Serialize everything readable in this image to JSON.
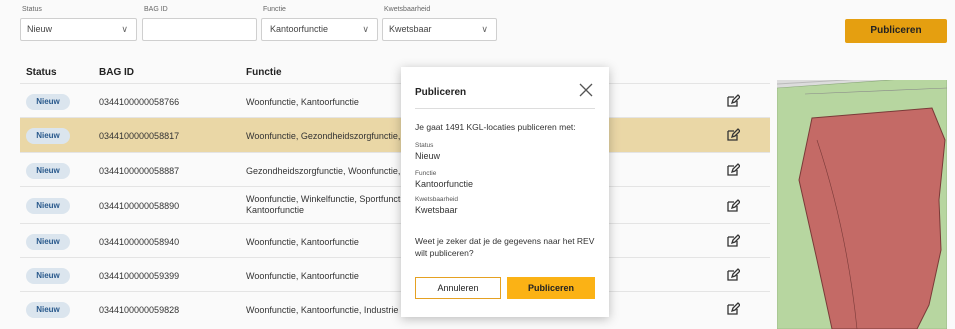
{
  "filters": {
    "status_label": "Status",
    "status_value": "Nieuw",
    "bag_label": "BAG ID",
    "bag_value": "",
    "functie_label": "Functie",
    "functie_value": "Kantoorfunctie",
    "kwets_label": "Kwetsbaarheid",
    "kwets_value": "Kwetsbaar",
    "publish_label": "Publiceren"
  },
  "table": {
    "headers": [
      "Status",
      "BAG ID",
      "Functie"
    ],
    "rows": [
      {
        "status": "Nieuw",
        "bag_id": "0344100000058766",
        "functie": "Woonfunctie, Kantoorfunctie"
      },
      {
        "status": "Nieuw",
        "bag_id": "0344100000058817",
        "functie": "Woonfunctie, Gezondheidszorgfunctie,"
      },
      {
        "status": "Nieuw",
        "bag_id": "0344100000058887",
        "functie": "Gezondheidszorgfunctie, Woonfunctie,"
      },
      {
        "status": "Nieuw",
        "bag_id": "0344100000058890",
        "functie": "Woonfunctie, Winkelfunctie, Sportfunct Kantoorfunctie"
      },
      {
        "status": "Nieuw",
        "bag_id": "0344100000058940",
        "functie": "Woonfunctie, Kantoorfunctie"
      },
      {
        "status": "Nieuw",
        "bag_id": "0344100000059399",
        "functie": "Woonfunctie, Kantoorfunctie"
      },
      {
        "status": "Nieuw",
        "bag_id": "0344100000059828",
        "functie": "Woonfunctie, Kantoorfunctie, Industrie"
      }
    ]
  },
  "modal": {
    "title": "Publiceren",
    "intro": "Je gaat 1491 KGL-locaties publiceren met:",
    "status_label": "Status",
    "status_value": "Nieuw",
    "functie_label": "Functie",
    "functie_value": "Kantoorfunctie",
    "kwets_label": "Kwetsbaarheid",
    "kwets_value": "Kwetsbaar",
    "question": "Weet je zeker dat je de gegevens naar het REV wilt publiceren?",
    "cancel_label": "Annuleren",
    "confirm_label": "Publiceren"
  },
  "colors": {
    "accent": "#fbb215",
    "selected_row": "#ead7a6",
    "badge_bg": "#dbe5ee",
    "badge_text": "#29598c",
    "map_green": "#b7d6a0",
    "map_red": "#c46a66"
  },
  "icons": [
    "chevron-down-icon",
    "edit-icon",
    "close-icon"
  ]
}
